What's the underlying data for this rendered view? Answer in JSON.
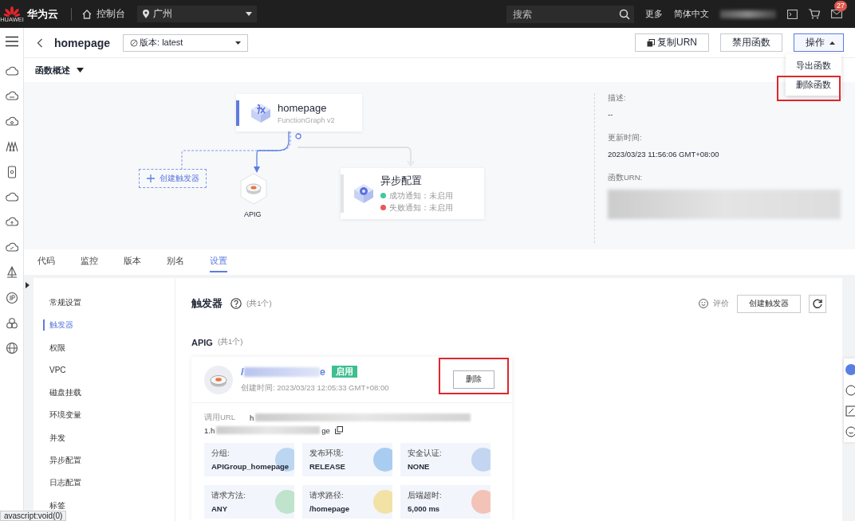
{
  "top_bar": {
    "logo_text": "HUAWEI",
    "brand": "华为云",
    "console": "控制台",
    "region": "广州",
    "search_placeholder": "搜索",
    "links": [
      "更多",
      "简体中文"
    ],
    "mail_badge": "27"
  },
  "header": {
    "title": "homepage",
    "version": "版本: latest",
    "buttons": [
      {
        "label": "复制URN",
        "kind": "copy"
      },
      {
        "label": "禁用函数",
        "kind": "plain"
      },
      {
        "label": "操作",
        "kind": "menu",
        "expanded": true
      }
    ]
  },
  "menu": [
    {
      "label": "导出函数",
      "highlighted": false
    },
    {
      "label": "删除函数",
      "highlighted": true
    }
  ],
  "overview": {
    "title": "函数概述",
    "function": {
      "name": "homepage",
      "subtitle": "FunctionGraph v2"
    },
    "create_trigger": "创建触发器",
    "trigger_name": "APIG",
    "async": {
      "title": "异步配置",
      "items": [
        {
          "label": "成功通知：未启用",
          "color": "#3ec99e"
        },
        {
          "label": "失败通知：未启用",
          "color": "#e8585a"
        }
      ]
    },
    "info": [
      {
        "label": "描述:",
        "value": "--"
      },
      {
        "label": "更新时间:",
        "value": "2023/03/23 11:56:06 GMT+08:00"
      },
      {
        "label": "函数URN:"
      }
    ]
  },
  "tabs": [
    {
      "label": "代码",
      "selected": false
    },
    {
      "label": "监控",
      "selected": false
    },
    {
      "label": "版本",
      "selected": false
    },
    {
      "label": "别名",
      "selected": false
    },
    {
      "label": "设置",
      "selected": true
    }
  ],
  "settings_nav": [
    {
      "label": "常规设置",
      "selected": false
    },
    {
      "label": "触发器",
      "selected": true
    },
    {
      "label": "权限",
      "selected": false
    },
    {
      "label": "VPC",
      "selected": false
    },
    {
      "label": "磁盘挂载",
      "selected": false
    },
    {
      "label": "环境变量",
      "selected": false
    },
    {
      "label": "并发",
      "selected": false
    },
    {
      "label": "异步配置",
      "selected": false
    },
    {
      "label": "日志配置",
      "selected": false
    },
    {
      "label": "标签",
      "selected": false
    }
  ],
  "triggers": {
    "title": "触发器",
    "count": "(共1个)",
    "rate": "评价",
    "create_button": "创建触发器",
    "group": "APIG",
    "group_count": "(共1个)",
    "card": {
      "name_start": "/",
      "name_end": "e",
      "status": "启用",
      "created": "创建时间:  2023/03/23 12:05:33 GMT+08:00",
      "delete_button": "删除",
      "delete_highlighted": true,
      "url_label": "调用URL",
      "url_line1": "h",
      "url_line2_start": "1.h",
      "url_line2_end": "ge",
      "tiles": [
        {
          "label": "分组:",
          "value": "APIGroup_homepage",
          "color": "#bcd6f2"
        },
        {
          "label": "发布环境:",
          "value": "RELEASE",
          "color": "#a9cdf0"
        },
        {
          "label": "安全认证:",
          "value": "NONE",
          "color": "#c3d5f0"
        },
        {
          "label": "请求方法:",
          "value": "ANY",
          "color": "#bfe3cc"
        },
        {
          "label": "请求路径:",
          "value": "/homepage",
          "color": "#f3e2a6"
        },
        {
          "label": "后端超时:",
          "value": "5,000 ms",
          "color": "#f3c3b8"
        }
      ]
    }
  },
  "status_text": "avascript:void(0)"
}
